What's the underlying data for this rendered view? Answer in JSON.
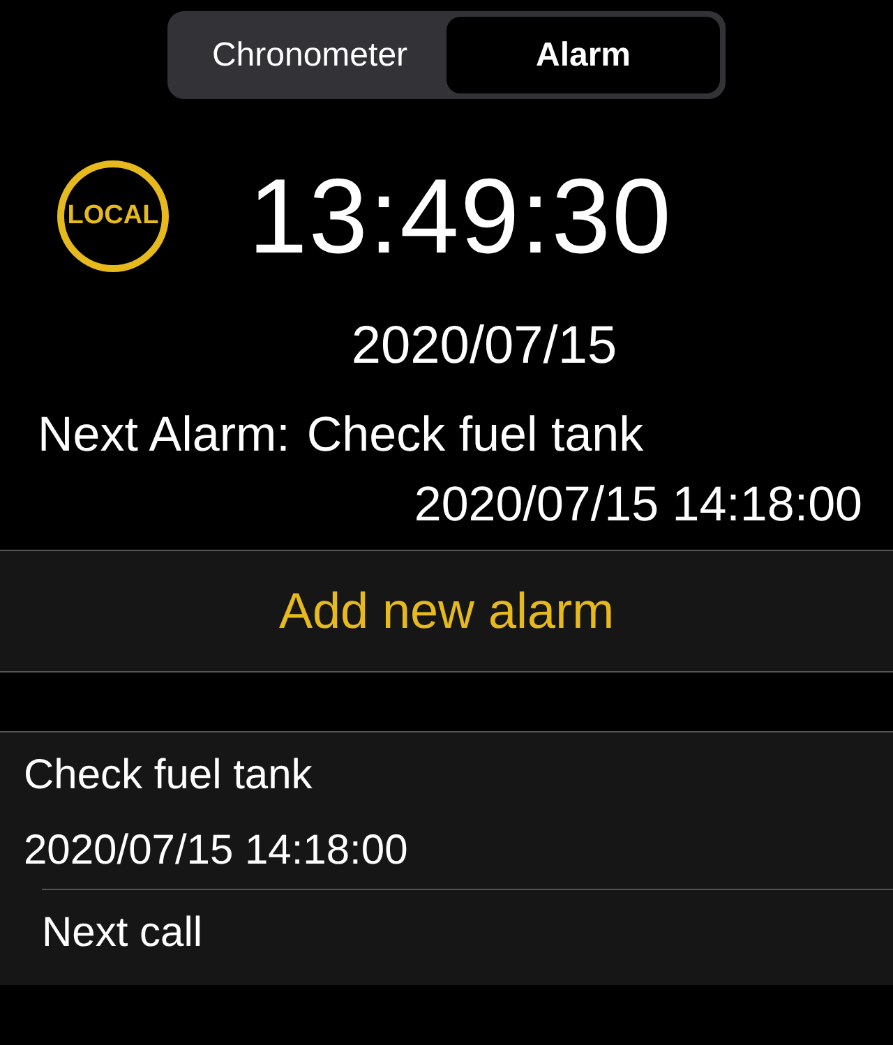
{
  "tabs": [
    {
      "label": "Chronometer",
      "selected": false
    },
    {
      "label": "Alarm",
      "selected": true
    }
  ],
  "clock": {
    "badge": "LOCAL",
    "time": "13:49:30",
    "date": "2020/07/15"
  },
  "next_alarm": {
    "label": "Next Alarm:",
    "name": "Check fuel tank",
    "when": "2020/07/15 14:18:00"
  },
  "add_button": "Add new alarm",
  "alarms": [
    {
      "title": "Check fuel tank",
      "when": "2020/07/15 14:18:00"
    },
    {
      "title": "Next call"
    }
  ]
}
